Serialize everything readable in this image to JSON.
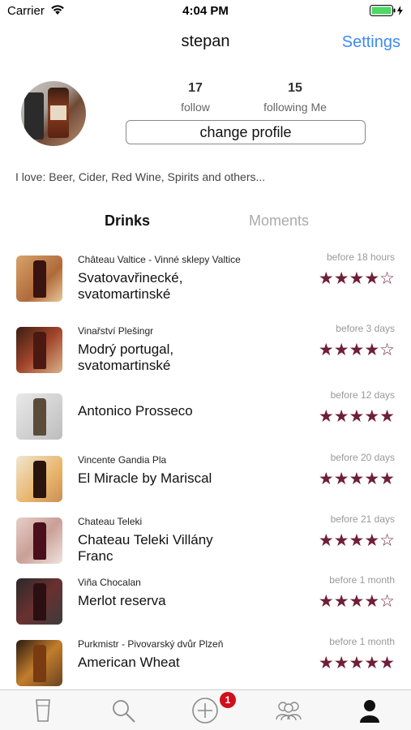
{
  "status_bar": {
    "carrier": "Carrier",
    "time": "4:04 PM",
    "wifi_icon": "wifi-icon",
    "battery_icon": "battery-charging-icon"
  },
  "nav": {
    "title": "stepan",
    "settings_label": "Settings"
  },
  "profile": {
    "follow_count": "17",
    "follow_label": "follow",
    "following_count": "15",
    "following_label": "following Me",
    "change_profile_label": "change profile",
    "bio": "I love: Beer, Cider, Red Wine, Spirits and others..."
  },
  "tabs": [
    {
      "label": "Drinks",
      "active": true
    },
    {
      "label": "Moments",
      "active": false
    }
  ],
  "drinks": [
    {
      "producer": "Château Valtice - Vinné sklepy Valtice",
      "name": "Svatovavřinecké, svatomartinské",
      "time": "before 18 hours",
      "rating": 4
    },
    {
      "producer": "Vinařství Plešingr",
      "name": "Modrý portugal, svatomartinské",
      "time": "before 3 days",
      "rating": 4
    },
    {
      "producer": "",
      "name": "Antonico Prosseco",
      "time": "before 12 days",
      "rating": 5
    },
    {
      "producer": "Vincente Gandia Pla",
      "name": "El Miracle by Mariscal",
      "time": "before 20 days",
      "rating": 5
    },
    {
      "producer": "Chateau Teleki",
      "name": "Chateau Teleki Villány Franc",
      "time": "before 21 days",
      "rating": 4
    },
    {
      "producer": "Viña Chocalan",
      "name": "Merlot reserva",
      "time": "before 1 month",
      "rating": 4
    },
    {
      "producer": "Purkmistr - Pivovarský dvůr Plzeň",
      "name": "American Wheat",
      "time": "before 1 month",
      "rating": 5
    }
  ],
  "tab_bar": {
    "items": [
      "glass-icon",
      "search-icon",
      "add-circle-icon",
      "friends-icon",
      "profile-icon"
    ],
    "badge_count": "1"
  },
  "colors": {
    "accent": "#3d8bf0",
    "rating": "#6e1f37",
    "badge": "#d0101b"
  }
}
